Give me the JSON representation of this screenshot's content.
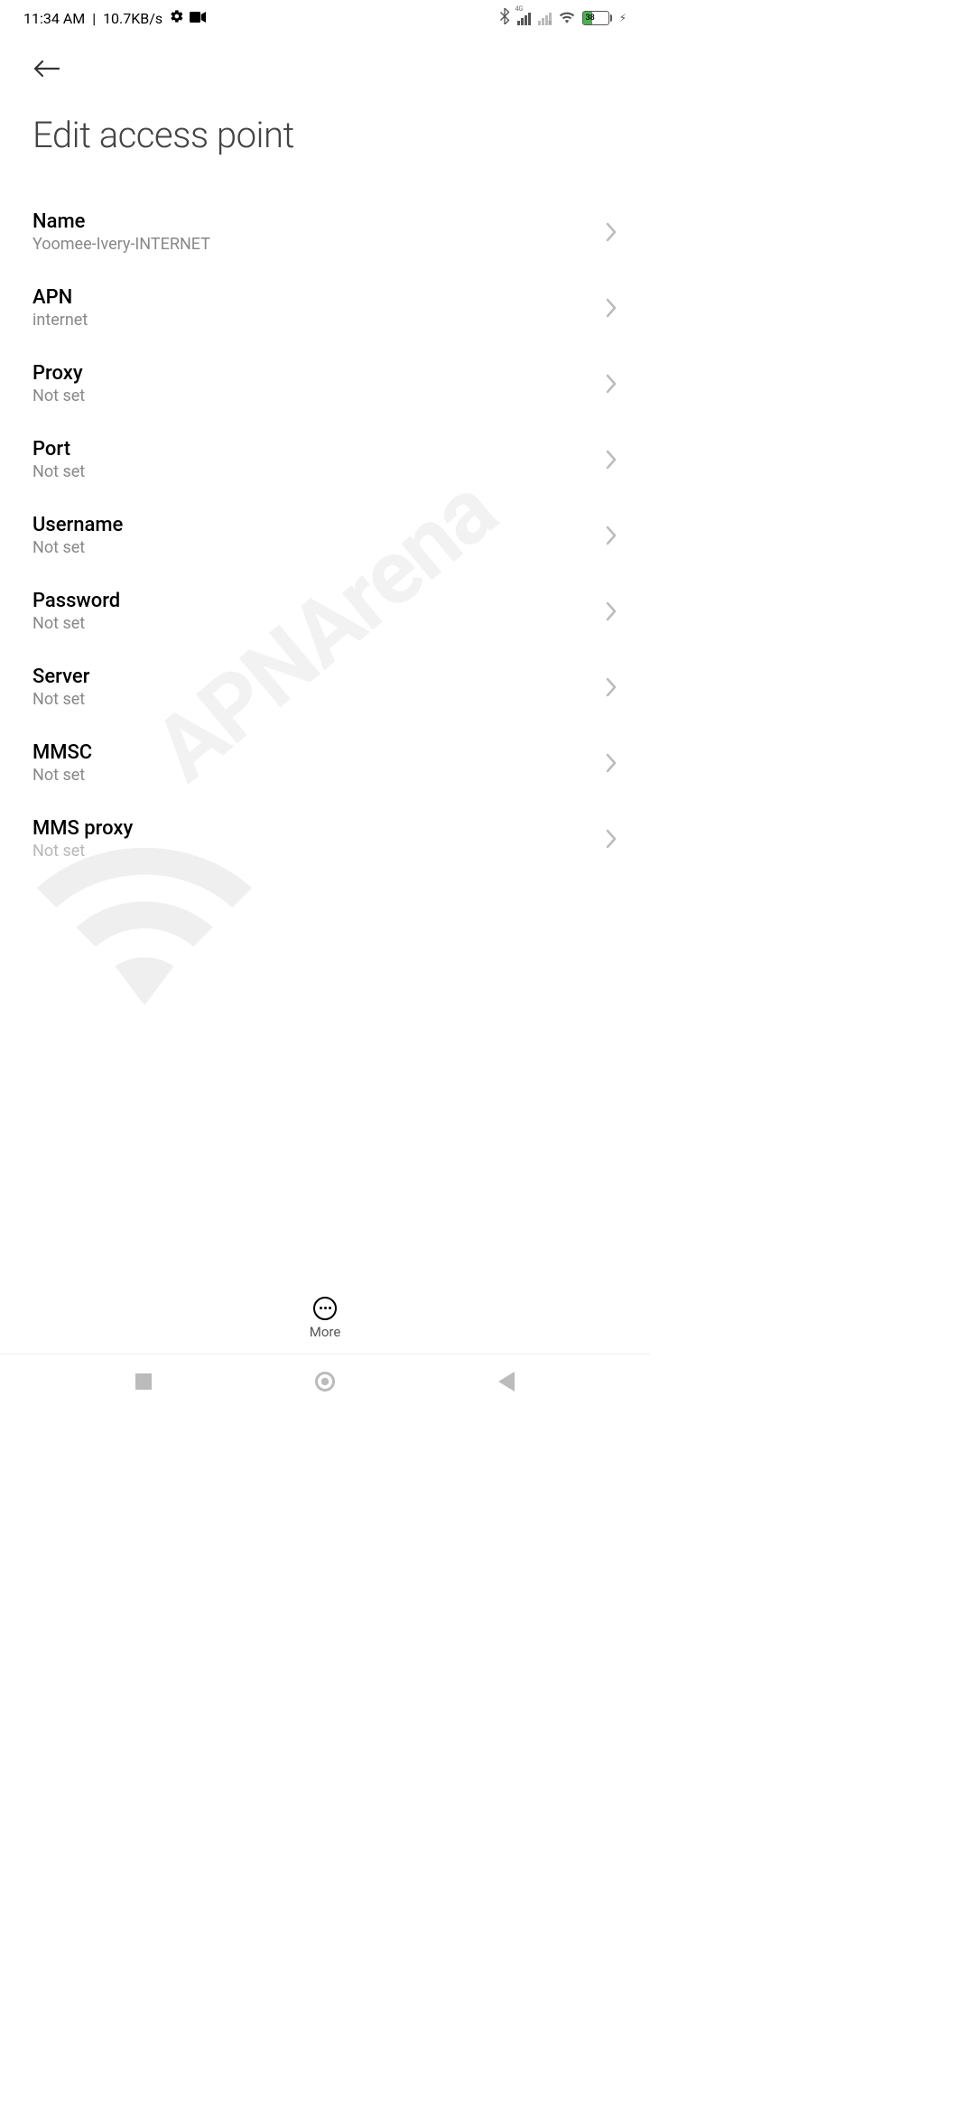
{
  "status": {
    "time": "11:34 AM",
    "net_speed": "10.7KB/s",
    "network_type": "4G",
    "battery_percent": "38"
  },
  "page": {
    "title": "Edit access point"
  },
  "fields": {
    "name": {
      "label": "Name",
      "value": "Yoomee-Ivery-INTERNET"
    },
    "apn": {
      "label": "APN",
      "value": "internet"
    },
    "proxy": {
      "label": "Proxy",
      "value": "Not set"
    },
    "port": {
      "label": "Port",
      "value": "Not set"
    },
    "username": {
      "label": "Username",
      "value": "Not set"
    },
    "password": {
      "label": "Password",
      "value": "Not set"
    },
    "server": {
      "label": "Server",
      "value": "Not set"
    },
    "mmsc": {
      "label": "MMSC",
      "value": "Not set"
    },
    "mms_proxy": {
      "label": "MMS proxy",
      "value": "Not set"
    }
  },
  "actions": {
    "more": "More"
  },
  "watermark": "APNArena"
}
